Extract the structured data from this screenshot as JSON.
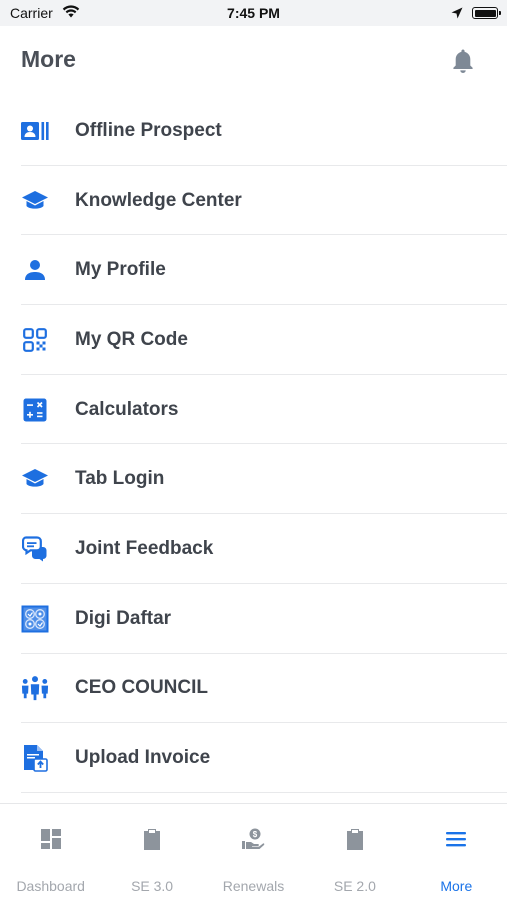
{
  "status_bar": {
    "carrier": "Carrier",
    "time": "7:45 PM"
  },
  "header": {
    "title": "More"
  },
  "menu": [
    {
      "label": "Offline Prospect",
      "icon": "id-card-icon"
    },
    {
      "label": "Knowledge Center",
      "icon": "graduation-cap-icon"
    },
    {
      "label": "My Profile",
      "icon": "person-icon"
    },
    {
      "label": "My QR Code",
      "icon": "qr-code-icon"
    },
    {
      "label": "Calculators",
      "icon": "calculator-icon"
    },
    {
      "label": "Tab Login",
      "icon": "graduation-cap-icon"
    },
    {
      "label": "Joint Feedback",
      "icon": "chat-bubbles-icon"
    },
    {
      "label": "Digi Daftar",
      "icon": "digi-daftar-icon"
    },
    {
      "label": "CEO COUNCIL",
      "icon": "team-icon"
    },
    {
      "label": "Upload Invoice",
      "icon": "upload-document-icon"
    }
  ],
  "tabs": [
    {
      "label": "Dashboard",
      "icon": "dashboard-icon",
      "active": false
    },
    {
      "label": "SE 3.0",
      "icon": "clipboard-icon",
      "active": false
    },
    {
      "label": "Renewals",
      "icon": "hand-coin-icon",
      "active": false
    },
    {
      "label": "SE 2.0",
      "icon": "clipboard-icon",
      "active": false
    },
    {
      "label": "More",
      "icon": "menu-icon",
      "active": true
    }
  ],
  "colors": {
    "accent": "#1a73e8",
    "icon_blue": "#1e6fe0",
    "inactive": "#a3a7ad",
    "bell": "#7e8996"
  }
}
